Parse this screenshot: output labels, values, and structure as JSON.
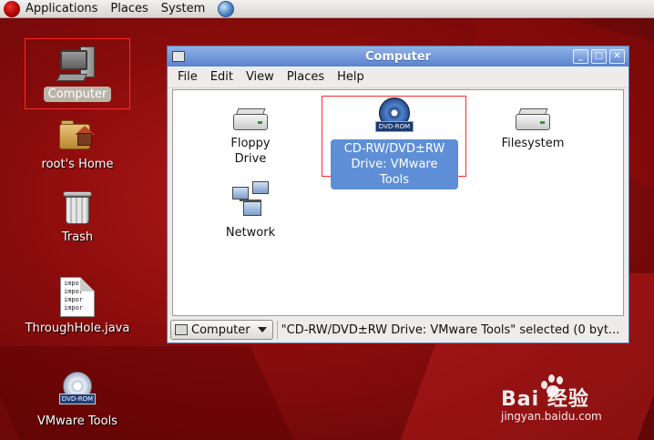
{
  "panel": {
    "menus": [
      "Applications",
      "Places",
      "System"
    ]
  },
  "desktop": {
    "icons": [
      {
        "label": "Computer"
      },
      {
        "label": "root's Home"
      },
      {
        "label": "Trash"
      },
      {
        "label": "ThroughHole.java",
        "preview": [
          "impor",
          "impor",
          "impor",
          "impor"
        ]
      },
      {
        "label": "VMware Tools",
        "badge": "DVD-ROM"
      }
    ]
  },
  "window": {
    "title": "Computer",
    "buttons": [
      "_",
      "□",
      "✕"
    ],
    "menu": [
      "File",
      "Edit",
      "View",
      "Places",
      "Help"
    ],
    "items": [
      {
        "label": "Floppy Drive"
      },
      {
        "label": "CD-RW/DVD±RW Drive: VMware Tools",
        "badge": "DVD-ROM",
        "selected": true
      },
      {
        "label": "Filesystem"
      },
      {
        "label": "Network"
      }
    ],
    "location": "Computer",
    "status": "\"CD-RW/DVD±RW Drive: VMware Tools\" selected (0 byt..."
  },
  "watermark": {
    "brand": "Bai 经验",
    "url": "jingyan.baidu.com"
  }
}
